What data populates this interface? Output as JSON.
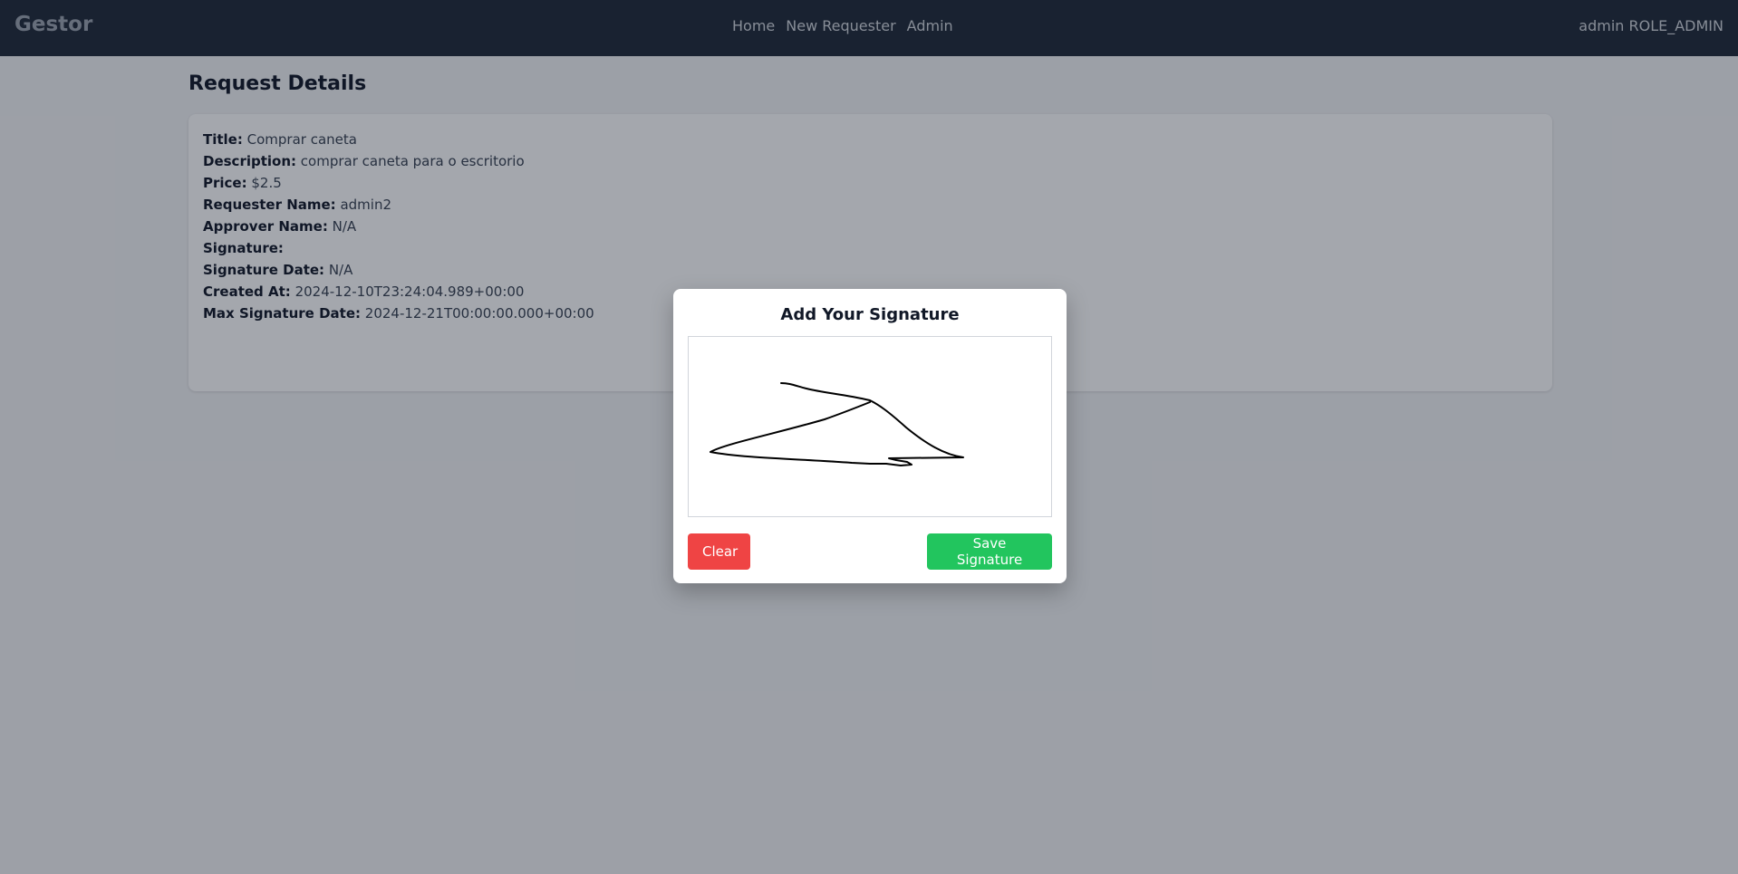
{
  "navbar": {
    "brand": "Gestor",
    "links": [
      "Home",
      "New Requester",
      "Admin"
    ],
    "user": "admin ROLE_ADMIN"
  },
  "page": {
    "title": "Request Details"
  },
  "details": [
    {
      "label": "Title:",
      "value": "Comprar caneta"
    },
    {
      "label": "Description:",
      "value": "comprar caneta para o escritorio"
    },
    {
      "label": "Price:",
      "value": "$2.5"
    },
    {
      "label": "Requester Name:",
      "value": "admin2"
    },
    {
      "label": "Approver Name:",
      "value": "N/A"
    },
    {
      "label": "Signature:",
      "value": ""
    },
    {
      "label": "Signature Date:",
      "value": "N/A"
    },
    {
      "label": "Created At:",
      "value": "2024-12-10T23:24:04.989+00:00"
    },
    {
      "label": "Max Signature Date:",
      "value": "2024-12-21T00:00:00.000+00:00"
    }
  ],
  "modal": {
    "title": "Add Your Signature",
    "clear_label": "Clear",
    "save_label": "Save Signature"
  },
  "colors": {
    "navbar": "#1f2937",
    "clear_button": "#ef4444",
    "save_button": "#22c55e"
  }
}
